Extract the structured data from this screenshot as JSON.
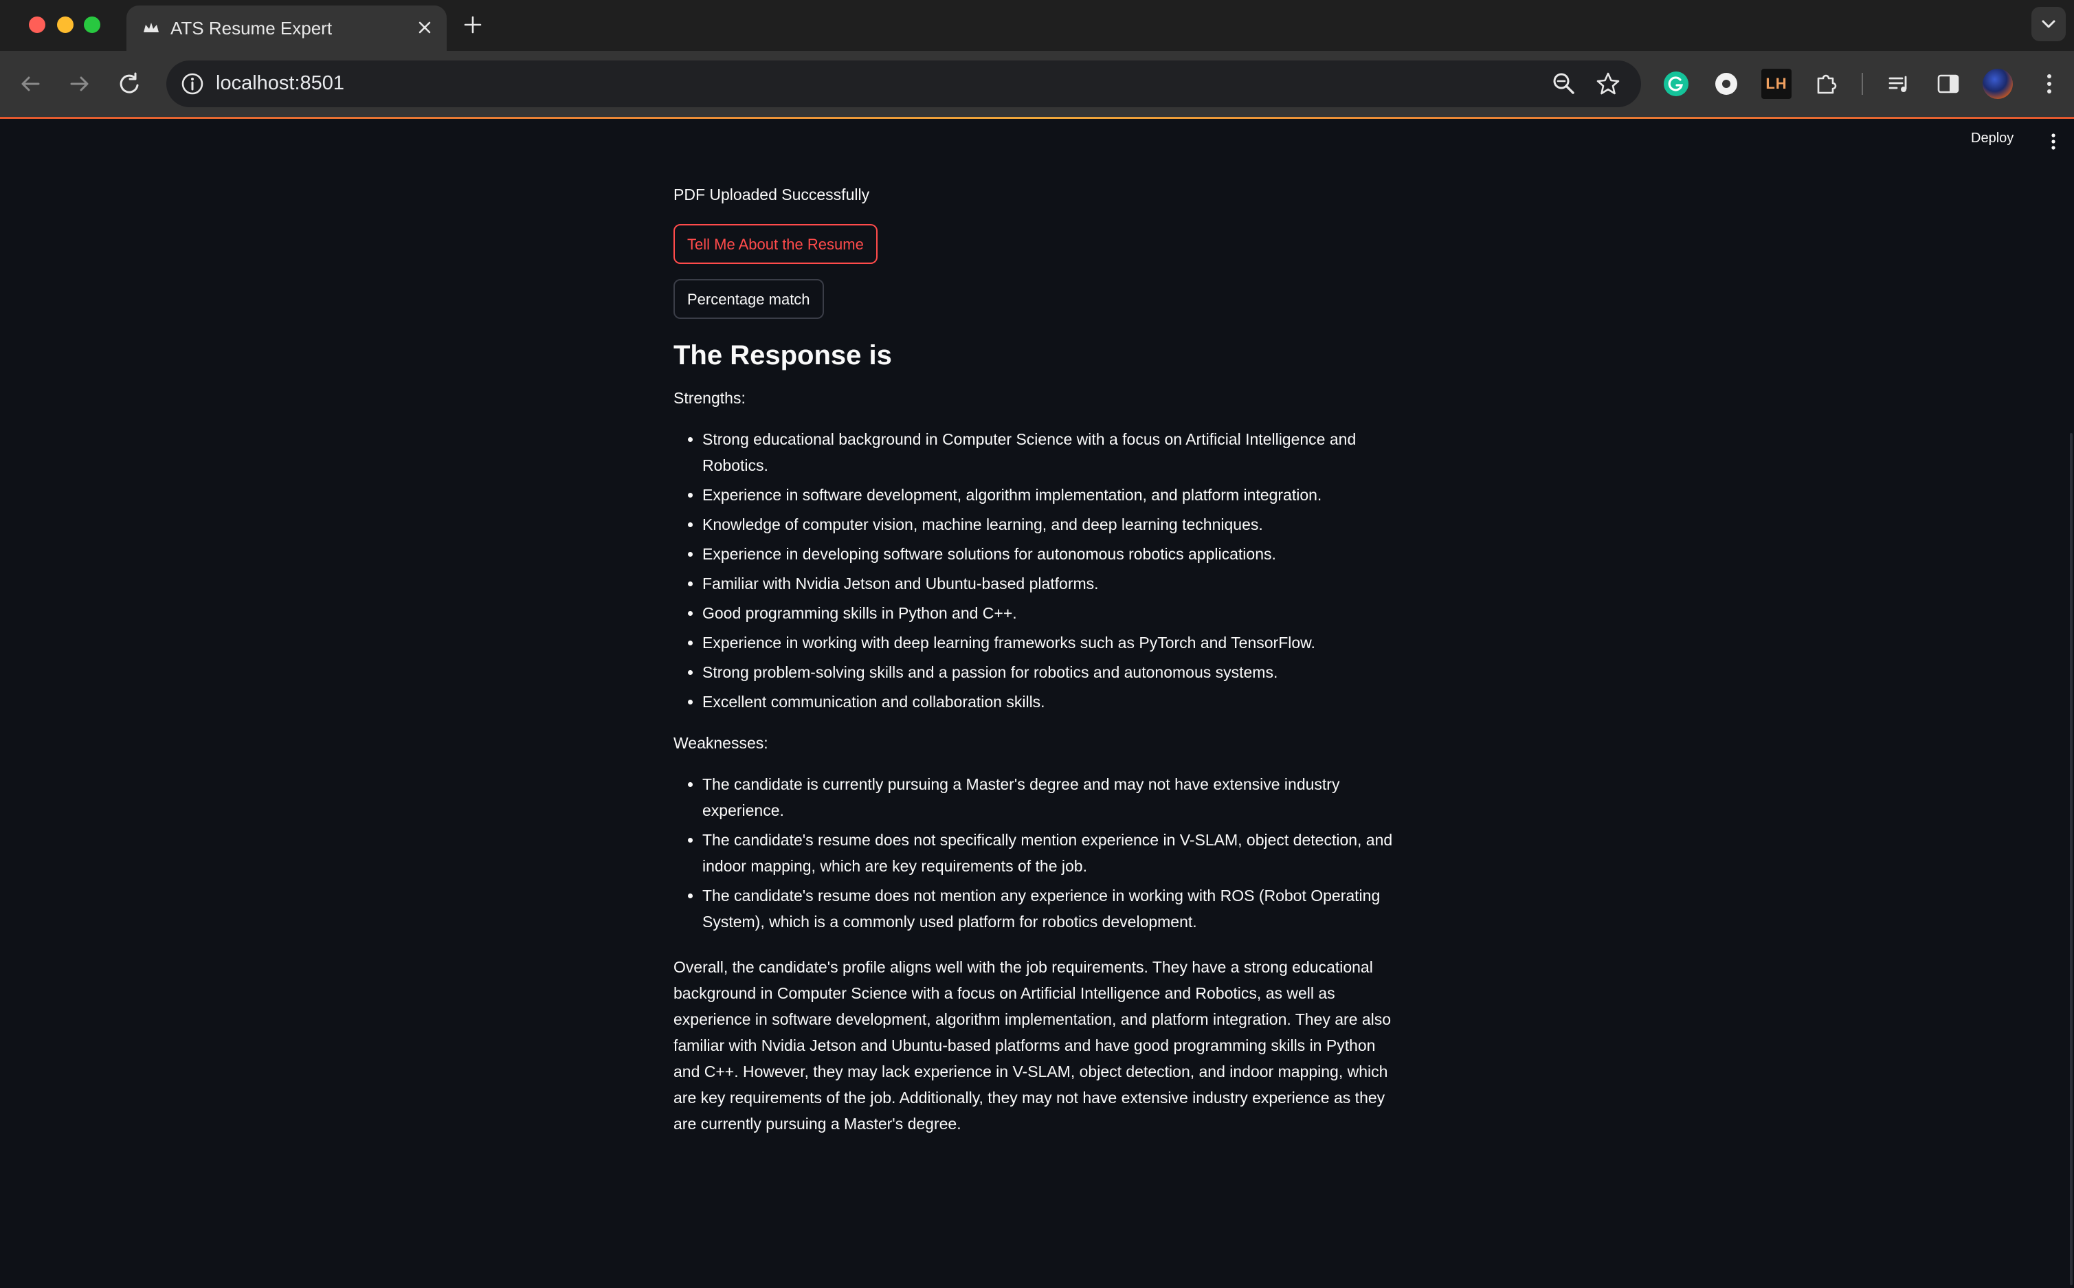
{
  "browser": {
    "tab_title": "ATS Resume Expert",
    "url": "localhost:8501",
    "icons": {
      "tab_favicon": "streamlit-crown-icon",
      "back": "arrow-left-icon",
      "forward": "arrow-right-icon",
      "reload": "reload-icon",
      "site_info": "info-icon",
      "zoom": "zoom-icon",
      "bookmark": "star-icon",
      "extensions": [
        "grammarly-icon",
        "circle-extension-icon",
        "lh-extension-icon",
        "puzzle-icon"
      ],
      "media": "media-queue-icon",
      "side_panel": "side-panel-icon",
      "profile": "avatar",
      "menu": "kebab-menu-icon"
    },
    "ext_lh_label": "LH",
    "colors": {
      "tab_strip": "#1f1f1f",
      "toolbar": "#353535",
      "omnibox": "#202124"
    }
  },
  "app": {
    "deploy_label": "Deploy",
    "status_text": "PDF Uploaded Successfully",
    "buttons": {
      "tell_me": "Tell Me About the Resume",
      "percentage": "Percentage match"
    },
    "response_title": "The Response is",
    "strengths_label": "Strengths:",
    "strengths": [
      "Strong educational background in Computer Science with a focus on Artificial Intelligence and Robotics.",
      "Experience in software development, algorithm implementation, and platform integration.",
      "Knowledge of computer vision, machine learning, and deep learning techniques.",
      "Experience in developing software solutions for autonomous robotics applications.",
      "Familiar with Nvidia Jetson and Ubuntu-based platforms.",
      "Good programming skills in Python and C++.",
      "Experience in working with deep learning frameworks such as PyTorch and TensorFlow.",
      "Strong problem-solving skills and a passion for robotics and autonomous systems.",
      "Excellent communication and collaboration skills."
    ],
    "weaknesses_label": "Weaknesses:",
    "weaknesses": [
      "The candidate is currently pursuing a Master's degree and may not have extensive industry experience.",
      "The candidate's resume does not specifically mention experience in V-SLAM, object detection, and indoor mapping, which are key requirements of the job.",
      "The candidate's resume does not mention any experience in working with ROS (Robot Operating System), which is a commonly used platform for robotics development."
    ],
    "summary": "Overall, the candidate's profile aligns well with the job requirements. They have a strong educational background in Computer Science with a focus on Artificial Intelligence and Robotics, as well as experience in software development, algorithm implementation, and platform integration. They are also familiar with Nvidia Jetson and Ubuntu-based platforms and have good programming skills in Python and C++. However, they may lack experience in V-SLAM, object detection, and indoor mapping, which are key requirements of the job. Additionally, they may not have extensive industry experience as they are currently pursuing a Master's degree.",
    "colors": {
      "background": "#0e1117",
      "primary": "#ff4b4b",
      "text": "#fafafa"
    }
  }
}
